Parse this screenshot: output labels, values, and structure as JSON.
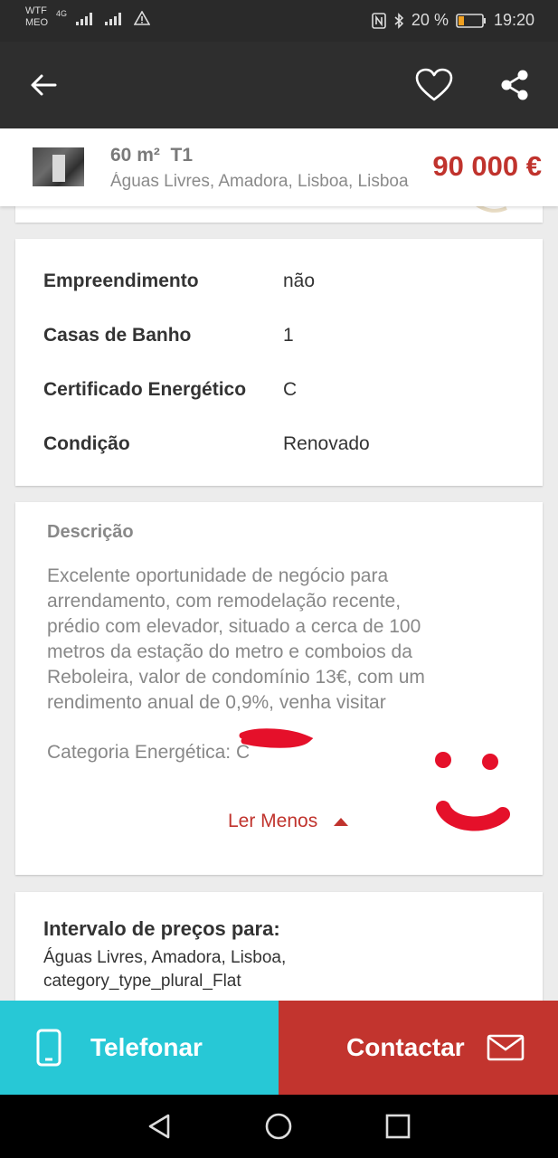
{
  "status_bar": {
    "carrier_line1": "WTF",
    "carrier_line2": "MEO",
    "network": "4G",
    "battery": "20 %",
    "time": "19:20",
    "icons": [
      "signal-icon",
      "signal-icon",
      "alert-icon",
      "nfc-icon",
      "bluetooth-icon",
      "battery-icon"
    ]
  },
  "app_bar": {
    "icons": [
      "back-arrow-icon",
      "heart-icon",
      "share-icon"
    ]
  },
  "summary": {
    "area": "60 m²",
    "typology": "T1",
    "location": "Águas Livres, Amadora, Lisboa, Lisboa",
    "price": "90 000 €"
  },
  "attributes": [
    {
      "label": "Empreendimento",
      "value": "não"
    },
    {
      "label": "Casas de Banho",
      "value": "1"
    },
    {
      "label": "Certificado Energético",
      "value": "C"
    },
    {
      "label": "Condição",
      "value": "Renovado"
    }
  ],
  "description": {
    "title": "Descrição",
    "lines": [
      "Excelente oportunidade de negócio para",
      "arrendamento, com remodelação recente,",
      "prédio com elevador, situado a cerca de 100",
      "metros da estação do metro e comboios da",
      "Reboleira, valor de condomínio 13€, com um",
      "rendimento anual de 0,9%, venha visitar"
    ],
    "energy_category": "Categoria Energética: C",
    "read_less": "Ler Menos"
  },
  "price_range": {
    "title": "Intervalo de preços para:",
    "line1": "Águas Livres, Amadora, Lisboa,",
    "line2": "category_type_plural_Flat"
  },
  "actions": {
    "call": "Telefonar",
    "contact": "Contactar"
  },
  "colors": {
    "accent_red": "#c0332d",
    "call_cyan": "#27c8d6",
    "annotation_red": "#e5102a"
  }
}
